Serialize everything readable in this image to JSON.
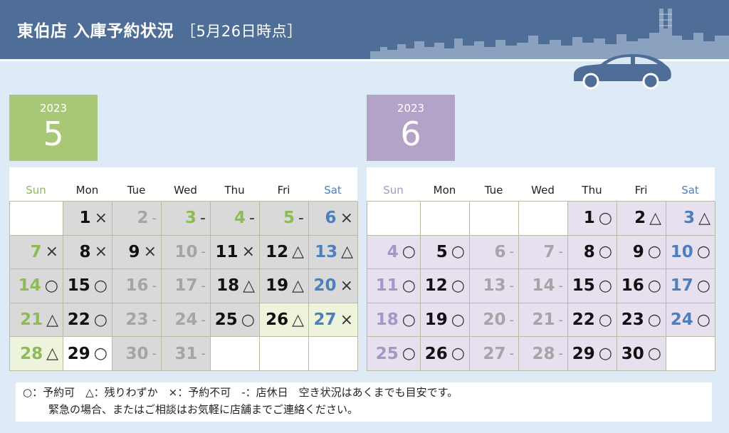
{
  "header": {
    "title": "東伯店 入庫予約状況",
    "subtitle": "［5月26日時点］"
  },
  "colors": {
    "header_bg": "#4e6e98",
    "sun_may": "#8dbb56",
    "sat": "#4d7fbd",
    "sun_jun": "#a994c6",
    "weekday": "#111111",
    "closed": "#a5a5a5",
    "fill_gray": "#d9d9d9",
    "fill_green": "#eef3dc",
    "fill_lavender": "#e7e0ee",
    "fill_white": "#ffffff"
  },
  "weekdays": [
    "Sun",
    "Mon",
    "Tue",
    "Wed",
    "Thu",
    "Fri",
    "Sat"
  ],
  "months": [
    {
      "key": "may",
      "year": "2023",
      "month": "5",
      "cells": [
        {
          "day": "",
          "mark": "",
          "kind": "blank",
          "fill": "fill_white"
        },
        {
          "day": "1",
          "mark": "×",
          "kind": "weekday",
          "fill": "fill_gray"
        },
        {
          "day": "2",
          "mark": "-",
          "kind": "closed",
          "fill": "fill_gray"
        },
        {
          "day": "3",
          "mark": "-",
          "kind": "sun_may",
          "fill": "fill_gray"
        },
        {
          "day": "4",
          "mark": "-",
          "kind": "sun_may",
          "fill": "fill_gray"
        },
        {
          "day": "5",
          "mark": "-",
          "kind": "sun_may",
          "fill": "fill_gray"
        },
        {
          "day": "6",
          "mark": "×",
          "kind": "sat",
          "fill": "fill_gray"
        },
        {
          "day": "7",
          "mark": "×",
          "kind": "sun_may",
          "fill": "fill_gray"
        },
        {
          "day": "8",
          "mark": "×",
          "kind": "weekday",
          "fill": "fill_gray"
        },
        {
          "day": "9",
          "mark": "×",
          "kind": "weekday",
          "fill": "fill_gray"
        },
        {
          "day": "10",
          "mark": "-",
          "kind": "closed",
          "fill": "fill_gray"
        },
        {
          "day": "11",
          "mark": "×",
          "kind": "weekday",
          "fill": "fill_gray"
        },
        {
          "day": "12",
          "mark": "△",
          "kind": "weekday",
          "fill": "fill_gray"
        },
        {
          "day": "13",
          "mark": "△",
          "kind": "sat",
          "fill": "fill_gray"
        },
        {
          "day": "14",
          "mark": "○",
          "kind": "sun_may",
          "fill": "fill_gray"
        },
        {
          "day": "15",
          "mark": "○",
          "kind": "weekday",
          "fill": "fill_gray"
        },
        {
          "day": "16",
          "mark": "-",
          "kind": "closed",
          "fill": "fill_gray"
        },
        {
          "day": "17",
          "mark": "-",
          "kind": "closed",
          "fill": "fill_gray"
        },
        {
          "day": "18",
          "mark": "△",
          "kind": "weekday",
          "fill": "fill_gray"
        },
        {
          "day": "19",
          "mark": "△",
          "kind": "weekday",
          "fill": "fill_gray"
        },
        {
          "day": "20",
          "mark": "×",
          "kind": "sat",
          "fill": "fill_gray"
        },
        {
          "day": "21",
          "mark": "△",
          "kind": "sun_may",
          "fill": "fill_gray"
        },
        {
          "day": "22",
          "mark": "○",
          "kind": "weekday",
          "fill": "fill_gray"
        },
        {
          "day": "23",
          "mark": "-",
          "kind": "closed",
          "fill": "fill_gray"
        },
        {
          "day": "24",
          "mark": "-",
          "kind": "closed",
          "fill": "fill_gray"
        },
        {
          "day": "25",
          "mark": "○",
          "kind": "weekday",
          "fill": "fill_gray"
        },
        {
          "day": "26",
          "mark": "△",
          "kind": "weekday",
          "fill": "fill_green"
        },
        {
          "day": "27",
          "mark": "×",
          "kind": "sat",
          "fill": "fill_green"
        },
        {
          "day": "28",
          "mark": "△",
          "kind": "sun_may",
          "fill": "fill_green"
        },
        {
          "day": "29",
          "mark": "○",
          "kind": "weekday",
          "fill": "fill_white"
        },
        {
          "day": "30",
          "mark": "-",
          "kind": "closed",
          "fill": "fill_gray"
        },
        {
          "day": "31",
          "mark": "-",
          "kind": "closed",
          "fill": "fill_gray"
        },
        {
          "day": "",
          "mark": "",
          "kind": "blank",
          "fill": "fill_white"
        },
        {
          "day": "",
          "mark": "",
          "kind": "blank",
          "fill": "fill_white"
        },
        {
          "day": "",
          "mark": "",
          "kind": "blank",
          "fill": "fill_white"
        }
      ]
    },
    {
      "key": "jun",
      "year": "2023",
      "month": "6",
      "cells": [
        {
          "day": "",
          "mark": "",
          "kind": "blank",
          "fill": "fill_white"
        },
        {
          "day": "",
          "mark": "",
          "kind": "blank",
          "fill": "fill_white"
        },
        {
          "day": "",
          "mark": "",
          "kind": "blank",
          "fill": "fill_white"
        },
        {
          "day": "",
          "mark": "",
          "kind": "blank",
          "fill": "fill_white"
        },
        {
          "day": "1",
          "mark": "○",
          "kind": "weekday",
          "fill": "fill_lavender"
        },
        {
          "day": "2",
          "mark": "△",
          "kind": "weekday",
          "fill": "fill_lavender"
        },
        {
          "day": "3",
          "mark": "△",
          "kind": "sat",
          "fill": "fill_lavender"
        },
        {
          "day": "4",
          "mark": "○",
          "kind": "sun_jun",
          "fill": "fill_lavender"
        },
        {
          "day": "5",
          "mark": "○",
          "kind": "weekday",
          "fill": "fill_lavender"
        },
        {
          "day": "6",
          "mark": "-",
          "kind": "closed",
          "fill": "fill_lavender"
        },
        {
          "day": "7",
          "mark": "-",
          "kind": "closed",
          "fill": "fill_lavender"
        },
        {
          "day": "8",
          "mark": "○",
          "kind": "weekday",
          "fill": "fill_lavender"
        },
        {
          "day": "9",
          "mark": "○",
          "kind": "weekday",
          "fill": "fill_lavender"
        },
        {
          "day": "10",
          "mark": "○",
          "kind": "sat",
          "fill": "fill_lavender"
        },
        {
          "day": "11",
          "mark": "○",
          "kind": "sun_jun",
          "fill": "fill_lavender"
        },
        {
          "day": "12",
          "mark": "○",
          "kind": "weekday",
          "fill": "fill_lavender"
        },
        {
          "day": "13",
          "mark": "-",
          "kind": "closed",
          "fill": "fill_lavender"
        },
        {
          "day": "14",
          "mark": "-",
          "kind": "closed",
          "fill": "fill_lavender"
        },
        {
          "day": "15",
          "mark": "○",
          "kind": "weekday",
          "fill": "fill_lavender"
        },
        {
          "day": "16",
          "mark": "○",
          "kind": "weekday",
          "fill": "fill_lavender"
        },
        {
          "day": "17",
          "mark": "○",
          "kind": "sat",
          "fill": "fill_lavender"
        },
        {
          "day": "18",
          "mark": "○",
          "kind": "sun_jun",
          "fill": "fill_lavender"
        },
        {
          "day": "19",
          "mark": "○",
          "kind": "weekday",
          "fill": "fill_lavender"
        },
        {
          "day": "20",
          "mark": "-",
          "kind": "closed",
          "fill": "fill_lavender"
        },
        {
          "day": "21",
          "mark": "-",
          "kind": "closed",
          "fill": "fill_lavender"
        },
        {
          "day": "22",
          "mark": "○",
          "kind": "weekday",
          "fill": "fill_lavender"
        },
        {
          "day": "23",
          "mark": "○",
          "kind": "weekday",
          "fill": "fill_lavender"
        },
        {
          "day": "24",
          "mark": "○",
          "kind": "sat",
          "fill": "fill_lavender"
        },
        {
          "day": "25",
          "mark": "○",
          "kind": "sun_jun",
          "fill": "fill_lavender"
        },
        {
          "day": "26",
          "mark": "○",
          "kind": "weekday",
          "fill": "fill_lavender"
        },
        {
          "day": "27",
          "mark": "-",
          "kind": "closed",
          "fill": "fill_lavender"
        },
        {
          "day": "28",
          "mark": "-",
          "kind": "closed",
          "fill": "fill_lavender"
        },
        {
          "day": "29",
          "mark": "○",
          "kind": "weekday",
          "fill": "fill_lavender"
        },
        {
          "day": "30",
          "mark": "○",
          "kind": "weekday",
          "fill": "fill_lavender"
        },
        {
          "day": "",
          "mark": "",
          "kind": "blank",
          "fill": "fill_white"
        }
      ]
    }
  ],
  "notice": {
    "line1": "○：予約可　△：残りわずか　×：予約不可　-：店休日　空き状況はあくまでも目安です。",
    "line2": "緊急の場合、またはご相談はお気軽に店舗までご連絡ください。"
  }
}
